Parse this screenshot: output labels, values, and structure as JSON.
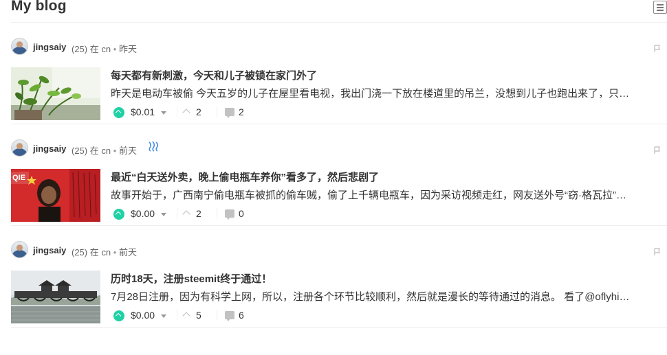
{
  "header": {
    "title": "My blog"
  },
  "posts": [
    {
      "author": "jingsaiy",
      "reputation": "(25)",
      "in_label": "在",
      "community": "cn",
      "separator": "•",
      "time": "昨天",
      "title": "每天都有新刺激，今天和儿子被锁在家门外了",
      "excerpt": "昨天是电动车被偷 今天五岁的儿子在屋里看电视，我出门浇一下放在楼道里的吊兰，没想到儿子也跑出来了，只…",
      "payout": "$0.01",
      "votes": "2",
      "comments": "2",
      "thumbnail": "plant-photo"
    },
    {
      "author": "jingsaiy",
      "reputation": "(25)",
      "in_label": "在",
      "community": "cn",
      "separator": "•",
      "time": "前天",
      "title": "最近“白天送外卖，晚上偷电瓶车养你”看多了，然后悲剧了",
      "excerpt": "故事开始于，广西南宁偷电瓶车被抓的偷车贼，偷了上千辆电瓶车，因为采访视频走红，网友送外号“窃·格瓦拉”…",
      "payout": "$0.00",
      "votes": "2",
      "comments": "0",
      "thumbnail": "poster-photo",
      "thumb_text": "QIE"
    },
    {
      "author": "jingsaiy",
      "reputation": "(25)",
      "in_label": "在",
      "community": "cn",
      "separator": "•",
      "time": "前天",
      "title": "历时18天，注册steemit终于通过！",
      "excerpt": "7月28日注册，因为有科学上网，所以，注册各个环节比较顺利，然后就是漫长的等待通过的消息。 看了@oflyhi…",
      "payout": "$0.00",
      "votes": "5",
      "comments": "6",
      "thumbnail": "bridge-photo"
    }
  ],
  "colors": {
    "upvote": "#1fd1a4",
    "steem_logo": "#4a90e2",
    "poster_red": "#d32b2b"
  },
  "icons": [
    "layout-toggle-icon",
    "flag-icon",
    "upvote-icon",
    "caret-down-icon",
    "chevron-up-icon",
    "comment-icon",
    "steem-logo-icon"
  ]
}
